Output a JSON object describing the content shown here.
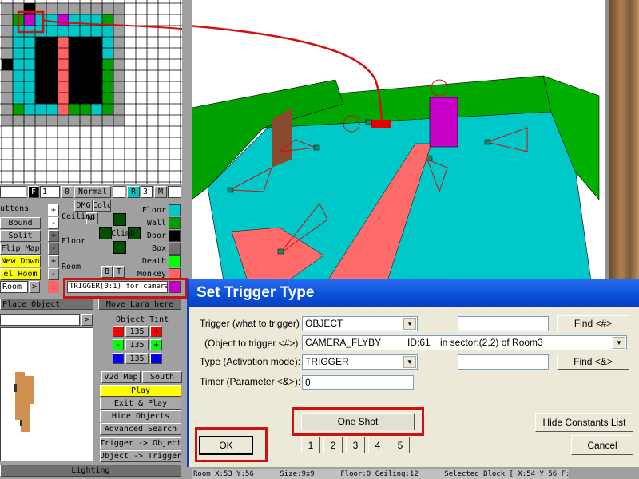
{
  "colors": {
    "floor": "#00c8c8",
    "wall": "#00a000",
    "door": "#000000",
    "box": "#707070",
    "death": "#00ff00",
    "monkey": "#ff6464",
    "trigger": "#c800c8",
    "highlight": "#d01010",
    "play": "#ffff00"
  },
  "toolbar": {
    "f_label": "F",
    "f_value": "1",
    "zero_label": "0",
    "normal_label": "Normal",
    "r_label": "R",
    "r_value": "3",
    "m_label": "M",
    "dmg_label": "DMG",
    "cold_label": "Cold",
    "nl_label": "NL",
    "climb_label": "Climb",
    "b_label": "B",
    "t_label": "T"
  },
  "left": {
    "buttons_header": "uttons",
    "bound": "Bound",
    "split": "Split",
    "flip_map": "Flip Map",
    "new_down": "New Down",
    "el_room": "el Room",
    "room_input": "Room",
    "arrow": ">"
  },
  "steppers": {
    "plus": "+",
    "minus": "-",
    "ceiling": "Ceiling",
    "floor": "Floor",
    "room": "Room"
  },
  "legend": [
    {
      "label": "Floor",
      "color": "#00c8c8"
    },
    {
      "label": "Wall",
      "color": "#00a000"
    },
    {
      "label": "Door",
      "color": "#000000"
    },
    {
      "label": "Box",
      "color": "#707070"
    },
    {
      "label": "Death",
      "color": "#00ff00"
    },
    {
      "label": "Monkey",
      "color": "#ff6464"
    }
  ],
  "trigger_text": "TRIGGER(0:1) for camera (",
  "place_object": "Place Object",
  "move_lara": "Move Lara here",
  "object_arrow": ">",
  "tint": {
    "title": "Object Tint",
    "red": "135",
    "green": "135",
    "blue": "135",
    "minus": "-",
    "plus": "+"
  },
  "nav": {
    "v2d_map": "V2d Map",
    "south": "South"
  },
  "actions": [
    "Play",
    "Exit & Play",
    "Hide Objects",
    "Advanced Search",
    "Trigger -> Object",
    "Object -> Trigger"
  ],
  "lighting": "Lighting",
  "dialog": {
    "title": "Set Trigger Type",
    "trigger_label": "Trigger (what to trigger) :",
    "trigger_value": "OBJECT",
    "object_label": "(Object to trigger <#>) :",
    "object_name": "CAMERA_FLYBY",
    "object_id": "ID:61",
    "object_sector": "in sector:(2,2) of Room3",
    "type_label": "Type (Activation mode):",
    "type_value": "TRIGGER",
    "timer_label": "Timer (Parameter <&>):",
    "timer_value": "0",
    "find_hash": "Find <#>",
    "find_amp": "Find <&>",
    "one_shot": "One Shot",
    "codebits": [
      "1",
      "2",
      "3",
      "4",
      "5"
    ],
    "hide_constants": "Hide Constants List",
    "ok": "OK",
    "cancel": "Cancel"
  },
  "status": "Room X:53 Y:56      Size:9x9      Floor:0 Ceiling:12      Selected Block [ X:54 Y:56 F:0 C:12 ]"
}
